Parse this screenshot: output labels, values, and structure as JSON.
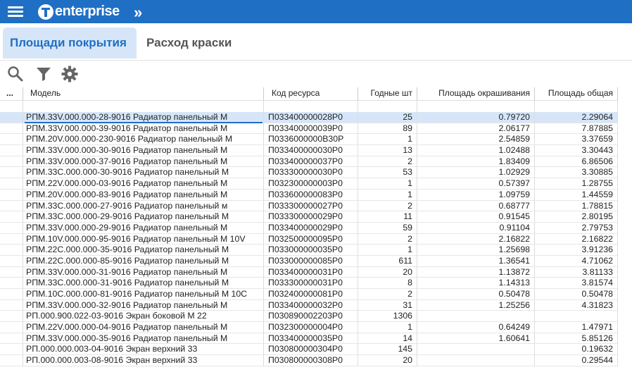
{
  "app": {
    "brand": "enterprise"
  },
  "tabs": [
    {
      "label": "Площади покрытия",
      "active": true
    },
    {
      "label": "Расход краски",
      "active": false
    }
  ],
  "toolbar": {
    "icons": [
      "search-icon",
      "filter-icon",
      "gear-icon"
    ]
  },
  "table": {
    "menu_label": "...",
    "columns": [
      "Модель",
      "Код ресурса",
      "Годные шт",
      "Площадь окрашивания",
      "Площадь общая"
    ],
    "selected_row": 0,
    "rows": [
      [
        "РПМ.33V.000.000-28-9016 Радиатор панельный М",
        "П033400000028Р0",
        "25",
        "0.79720",
        "2.29064"
      ],
      [
        "РПМ.33V.000.000-39-9016 Радиатор панельный М",
        "П033400000039Р0",
        "89",
        "2.06177",
        "7.87885"
      ],
      [
        "РПМ.20V.000.000-230-9016 Радиатор панельный М",
        "П0336000000В30Р",
        "1",
        "2.54859",
        "3.37659"
      ],
      [
        "РПМ.33V.000.000-30-9016 Радиатор панельный М",
        "П033400000030Р0",
        "13",
        "1.02488",
        "3.30443"
      ],
      [
        "РПМ.33V.000.000-37-9016 Радиатор панельный М",
        "П033400000037Р0",
        "2",
        "1.83409",
        "6.86506"
      ],
      [
        "РПМ.33C.000.000-30-9016 Радиатор панельный М",
        "П033300000030Р0",
        "53",
        "1.02929",
        "3.30885"
      ],
      [
        "РПМ.22V.000.000-03-9016 Радиатор панельный М",
        "П032300000003Р0",
        "1",
        "0.57397",
        "1.28755"
      ],
      [
        "РПМ.20V.000.000-83-9016 Радиатор панельный М",
        "П033600000083Р0",
        "1",
        "1.09759",
        "1.44559"
      ],
      [
        "РПМ.33C.000.000-27-9016 Радиатор панельный м",
        "П033300000027Р0",
        "2",
        "0.68777",
        "1.78815"
      ],
      [
        "РПМ.33C.000.000-29-9016 Радиатор панельный М",
        "П033300000029Р0",
        "11",
        "0.91545",
        "2.80195"
      ],
      [
        "РПМ.33V.000.000-29-9016 Радиатор панельный М",
        "П033400000029Р0",
        "59",
        "0.91104",
        "2.79753"
      ],
      [
        "РПМ.10V.000.000-95-9016 Радиатор панельный М 10V",
        "П032500000095Р0",
        "2",
        "2.16822",
        "2.16822"
      ],
      [
        "РПМ.22C.000.000-35-9016 Радиатор панельный М",
        "П033000000035Р0",
        "1",
        "1.25698",
        "3.91236"
      ],
      [
        "РПМ.22C.000.000-85-9016 Радиатор панельный М",
        "П033000000085Р0",
        "611",
        "1.36541",
        "4.71062"
      ],
      [
        "РПМ.33V.000.000-31-9016 Радиатор панельный М",
        "П033400000031Р0",
        "20",
        "1.13872",
        "3.81133"
      ],
      [
        "РПМ.33C.000.000-31-9016 Радиатор панельный М",
        "П033300000031Р0",
        "8",
        "1.14313",
        "3.81574"
      ],
      [
        "РПМ.10C.000.000-81-9016 Радиатор панельный М 10C",
        "П032400000081Р0",
        "2",
        "0.50478",
        "0.50478"
      ],
      [
        "РПМ.33V.000.000-32-9016 Радиатор панельный М",
        "П033400000032Р0",
        "31",
        "1.25256",
        "4.31823"
      ],
      [
        "РП.000.900.022-03-9016 Экран боковой М 22",
        "П030890002203Р0",
        "1306",
        "",
        ""
      ],
      [
        "РПМ.22V.000.000-04-9016 Радиатор панельный М",
        "П032300000004Р0",
        "1",
        "0.64249",
        "1.47971"
      ],
      [
        "РПМ.33V.000.000-35-9016 Радиатор панельный М",
        "П033400000035Р0",
        "14",
        "1.60641",
        "5.85126"
      ],
      [
        "РП.000.000.003-04-9016 Экран верхний 33",
        "П030800000304Р0",
        "145",
        "",
        "0.19632"
      ],
      [
        "РП.000.000.003-08-9016 Экран верхний 33",
        "П030800000308Р0",
        "20",
        "",
        "0.29544"
      ]
    ]
  }
}
